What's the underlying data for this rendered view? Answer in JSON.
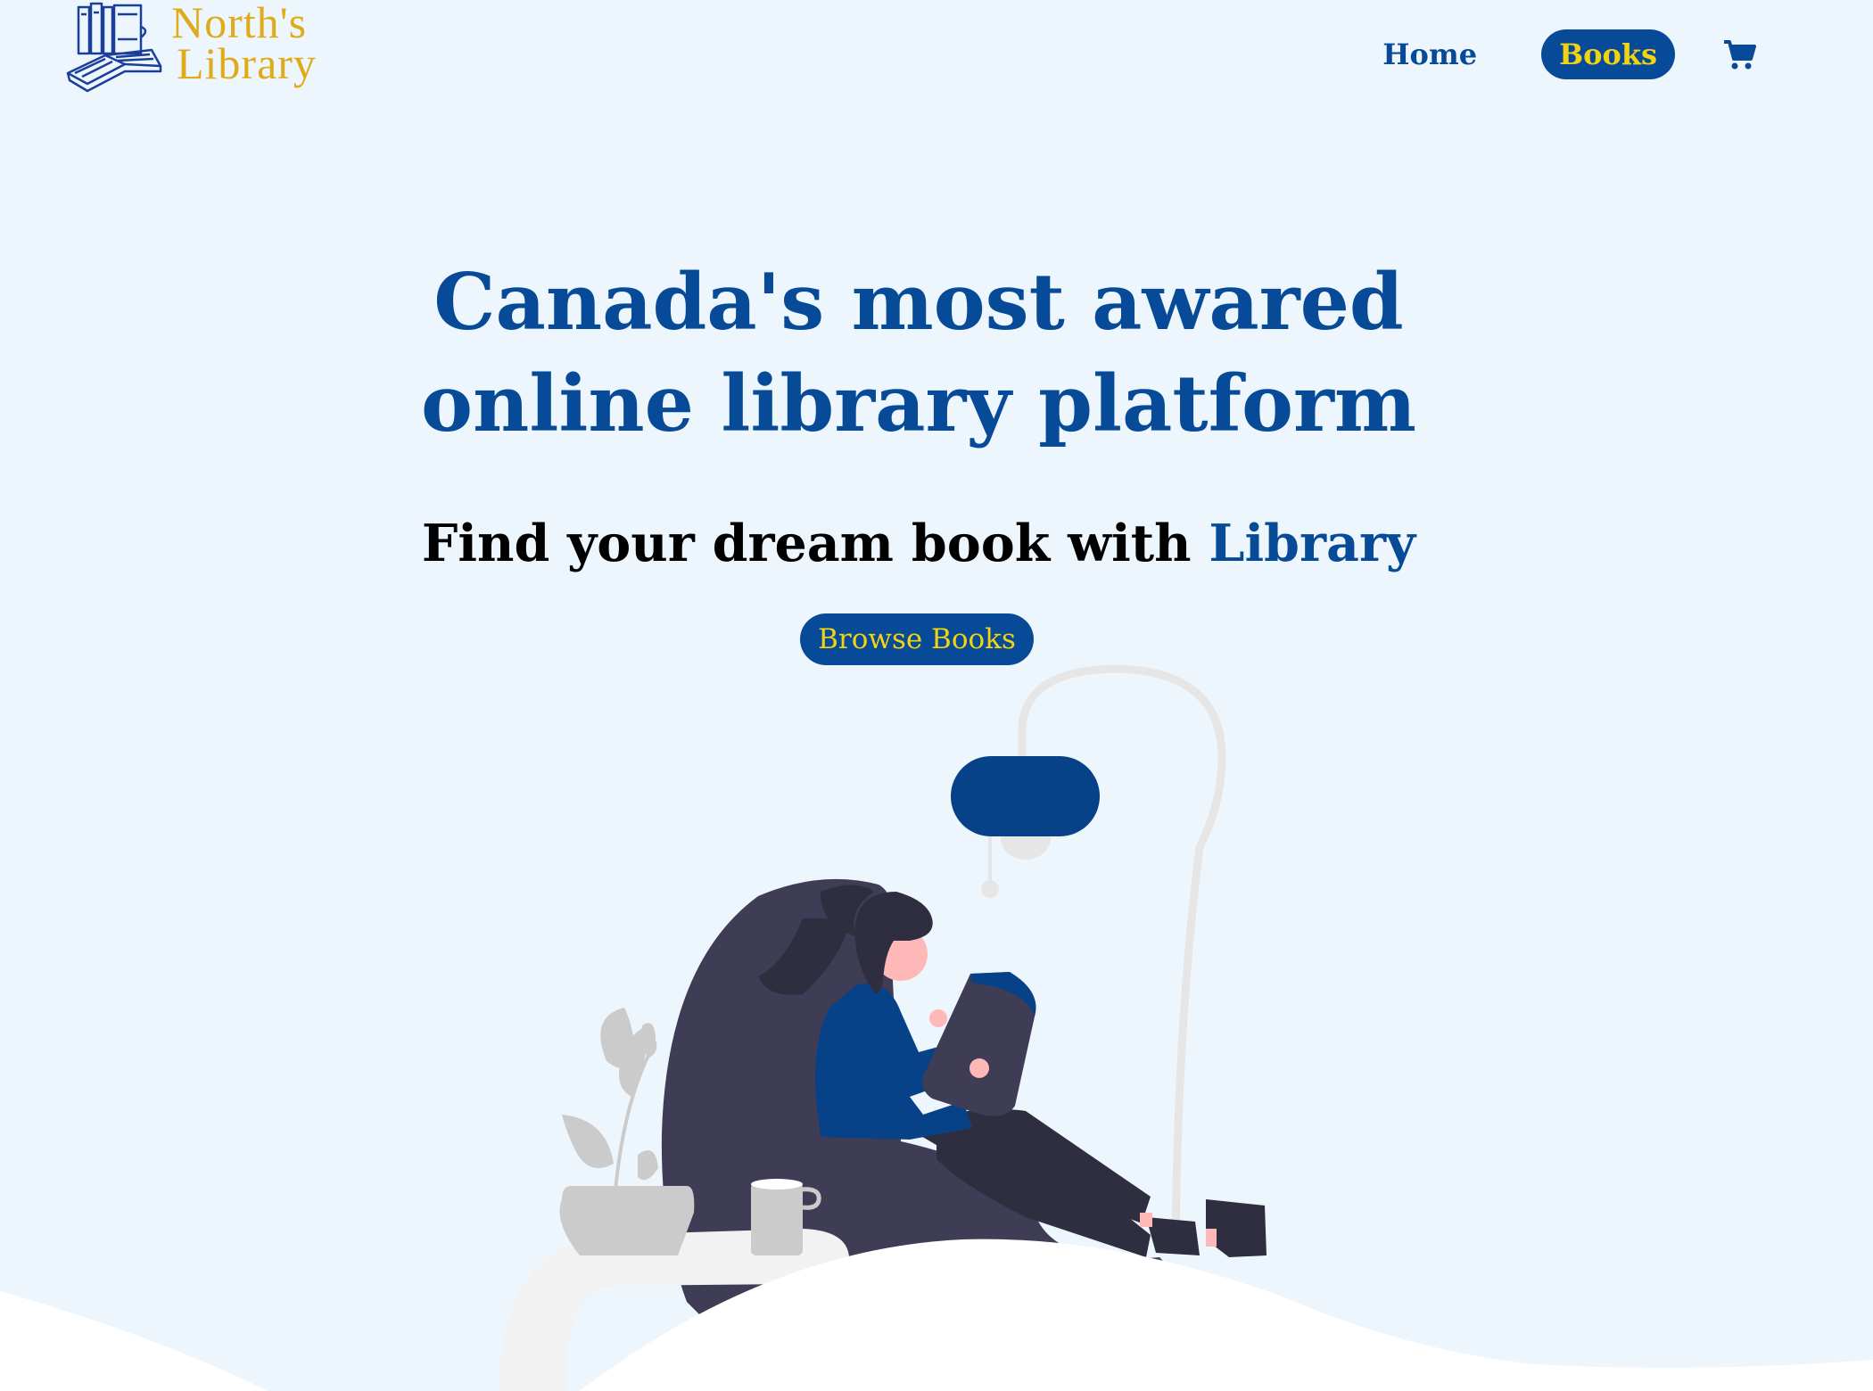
{
  "brand": {
    "line1": "North's",
    "line2": "Library"
  },
  "nav": {
    "home_label": "Home",
    "books_label": "Books",
    "cart_icon": "cart-icon"
  },
  "hero": {
    "title_line1": "Canada's most awared",
    "title_line2": "online library platform",
    "subtitle_prefix": "Find your dream book with",
    "subtitle_accent": "Library",
    "cta_label": "Browse Books"
  },
  "colors": {
    "background": "#eef6fd",
    "primary": "#074b98",
    "accent_yellow": "#f2d311",
    "logo_gold": "#e0ab1a"
  }
}
